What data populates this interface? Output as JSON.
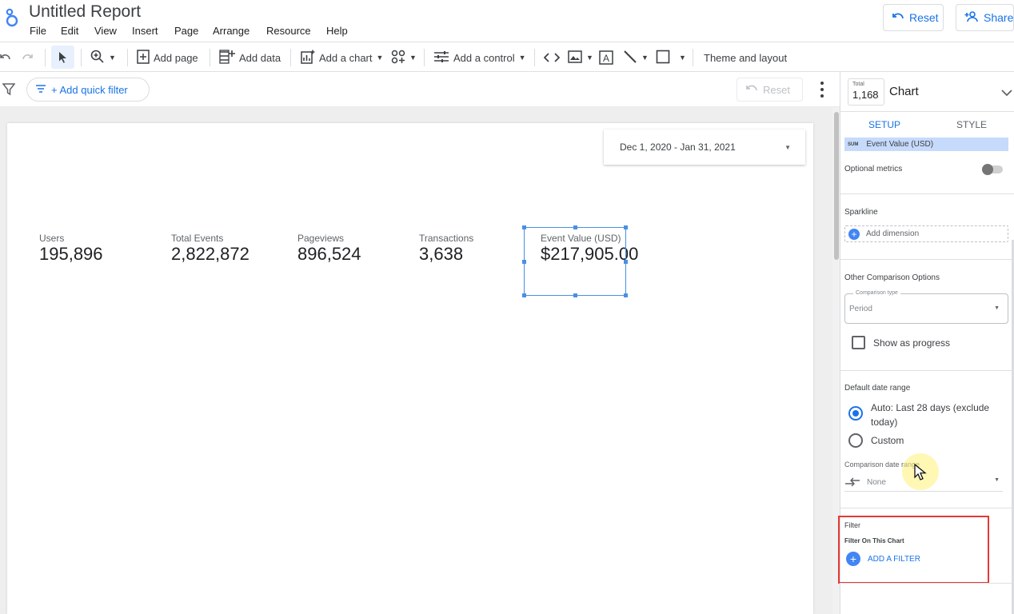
{
  "app": {
    "title": "Untitled Report"
  },
  "menu": [
    "File",
    "Edit",
    "View",
    "Insert",
    "Page",
    "Arrange",
    "Resource",
    "Help"
  ],
  "header_buttons": {
    "reset": "Reset",
    "share": "Share"
  },
  "toolbar": {
    "add_page": "Add page",
    "add_data": "Add data",
    "add_chart": "Add a chart",
    "add_control": "Add a control",
    "theme": "Theme and layout"
  },
  "filterbar": {
    "quick_filter": "+ Add quick filter",
    "reset": "Reset"
  },
  "date_range": "Dec 1, 2020 - Jan 31, 2021",
  "scorecards": [
    {
      "label": "Users",
      "value": "195,896"
    },
    {
      "label": "Total Events",
      "value": "2,822,872"
    },
    {
      "label": "Pageviews",
      "value": "896,524"
    },
    {
      "label": "Transactions",
      "value": "3,638"
    },
    {
      "label": "Event Value (USD)",
      "value": "$217,905.00"
    }
  ],
  "panel": {
    "total_label": "Total",
    "total_value": "1,168",
    "title": "Chart",
    "tabs": {
      "setup": "SETUP",
      "style": "STYLE"
    },
    "metric_tag": "SUM",
    "metric": "Event Value (USD)",
    "optional_metrics": "Optional metrics",
    "sparkline": "Sparkline",
    "add_dimension": "Add dimension",
    "other_comparison": "Other Comparison Options",
    "comparison_type_label": "Comparison type",
    "comparison_type_value": "Period",
    "show_progress": "Show as progress",
    "default_date_range": "Default date range",
    "auto_option": "Auto: Last 28 days (exclude today)",
    "custom_option": "Custom",
    "comparison_date_range": "Comparison date range",
    "comparison_none": "None",
    "filter": "Filter",
    "filter_on_chart": "Filter On This Chart",
    "add_filter": "ADD A FILTER"
  },
  "colors": {
    "accent": "#1a73e8",
    "highlight_box": "#e53935",
    "selection": "#4a90e2"
  }
}
